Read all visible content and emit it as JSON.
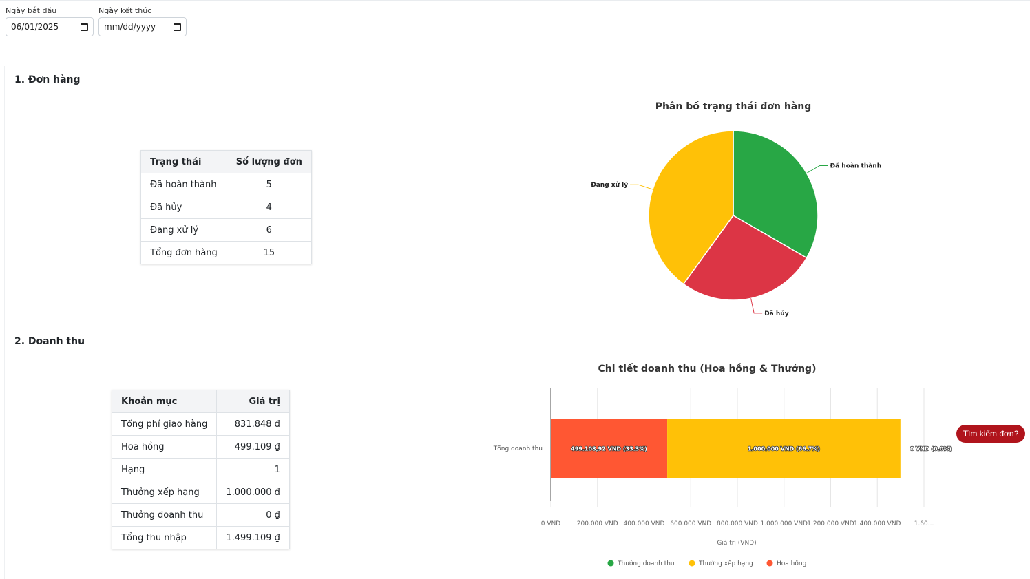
{
  "filters": {
    "start_label": "Ngày bắt đầu",
    "start_value": "06/01/2025",
    "end_label": "Ngày kết thúc",
    "end_value": "mm/dd/yyyy"
  },
  "orders": {
    "section_title": "1. Đơn hàng",
    "table": {
      "headers": [
        "Trạng thái",
        "Số lượng đơn"
      ],
      "rows": [
        [
          "Đã hoàn thành",
          "5"
        ],
        [
          "Đã hủy",
          "4"
        ],
        [
          "Đang xử lý",
          "6"
        ],
        [
          "Tổng đơn hàng",
          "15"
        ]
      ]
    }
  },
  "revenue": {
    "section_title": "2. Doanh thu",
    "table": {
      "headers": [
        "Khoản mục",
        "Giá trị"
      ],
      "rows": [
        [
          "Tổng phí giao hàng",
          "831.848 ₫"
        ],
        [
          "Hoa hồng",
          "499.109 ₫"
        ],
        [
          "Hạng",
          "1"
        ],
        [
          "Thưởng xếp hạng",
          "1.000.000 ₫"
        ],
        [
          "Thưởng doanh thu",
          "0 ₫"
        ],
        [
          "Tổng thu nhập",
          "1.499.109 ₫"
        ]
      ]
    }
  },
  "find_button": "Tìm kiếm đơn?",
  "chart_data": [
    {
      "type": "pie",
      "title": "Phân bố trạng thái đơn hàng",
      "labels": [
        "Đã hoàn thành",
        "Đã hủy",
        "Đang xử lý"
      ],
      "values": [
        5,
        4,
        6
      ],
      "colors": [
        "#28a745",
        "#dc3545",
        "#ffc107"
      ]
    },
    {
      "type": "bar",
      "orientation": "horizontal",
      "stacked": true,
      "title": "Chi tiết doanh thu (Hoa hồng & Thưởng)",
      "categories": [
        "Tổng doanh thu"
      ],
      "xlabel": "Giá trị (VND)",
      "xlim": [
        0,
        1600000
      ],
      "xticks": [
        "0 VND",
        "200.000 VND",
        "400.000 VND",
        "600.000 VND",
        "800.000 VND",
        "1.000.000 VND",
        "1.200.000 VND",
        "1.400.000 VND",
        "1.60..."
      ],
      "series": [
        {
          "name": "Hoa hồng",
          "values": [
            499108.92
          ],
          "label": "499.108,92 VND (33.3%)",
          "color": "#ff5733"
        },
        {
          "name": "Thưởng xếp hạng",
          "values": [
            1000000
          ],
          "label": "1.000.000 VND (66.7%)",
          "color": "#ffc107"
        },
        {
          "name": "Thưởng doanh thu",
          "values": [
            0
          ],
          "label": "0 VND (0.0%)",
          "color": "#28a745"
        }
      ],
      "legend": [
        "Thưởng doanh thu",
        "Thưởng xếp hạng",
        "Hoa hồng"
      ],
      "legend_position": "bottom"
    }
  ]
}
